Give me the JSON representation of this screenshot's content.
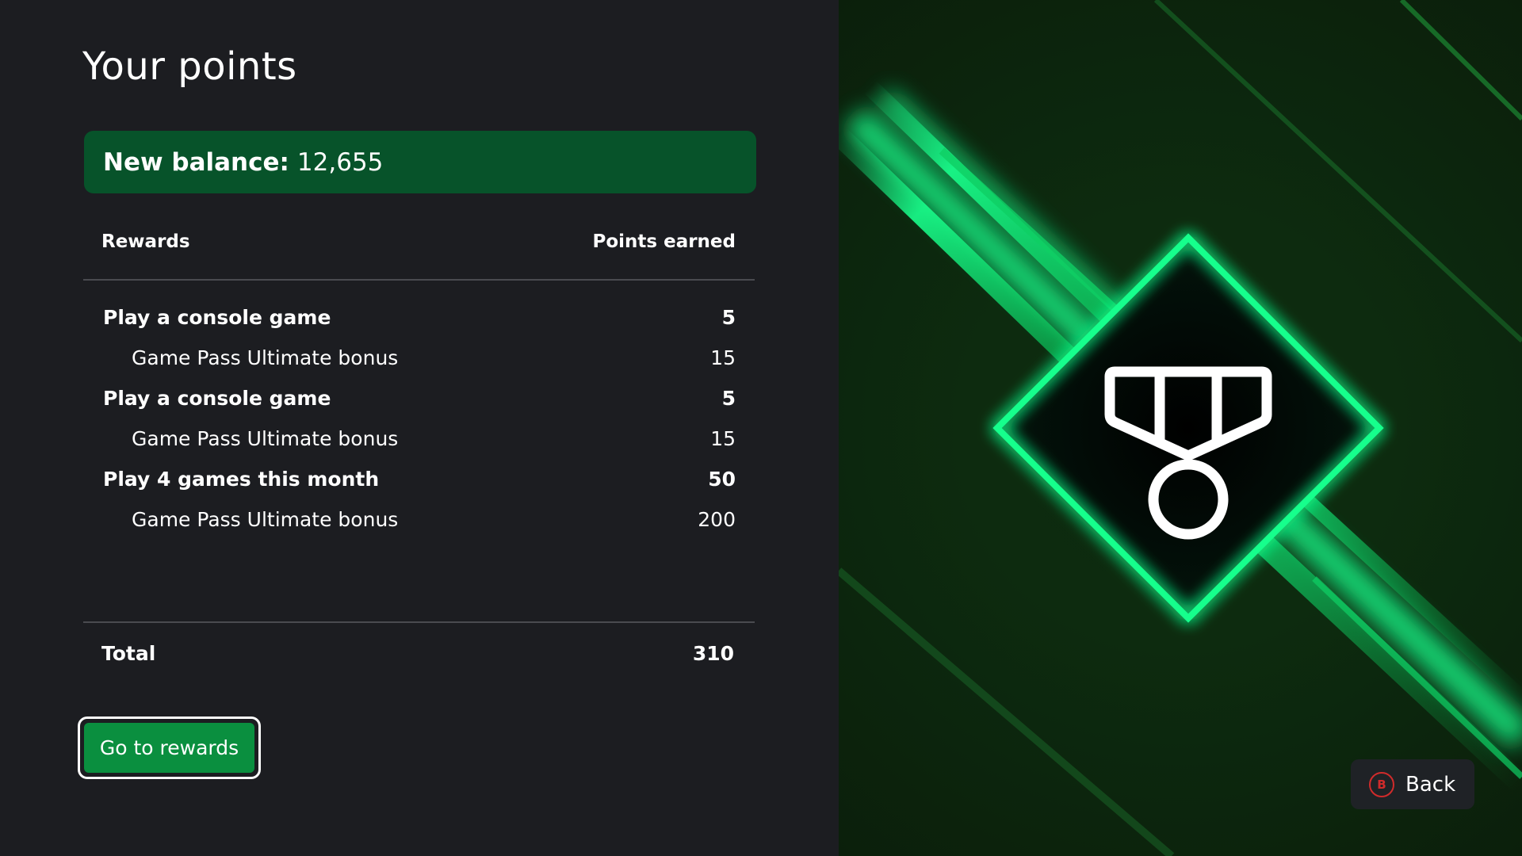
{
  "page": {
    "title": "Your points"
  },
  "balance": {
    "label": "New balance:",
    "value": "12,655"
  },
  "table": {
    "col_rewards": "Rewards",
    "col_points": "Points earned",
    "rows": [
      {
        "name": "Play a console game",
        "points": "5"
      },
      {
        "name": "Game Pass Ultimate bonus",
        "points": "15"
      },
      {
        "name": "Play a console game",
        "points": "5"
      },
      {
        "name": "Game Pass Ultimate bonus",
        "points": "15"
      },
      {
        "name": "Play 4 games this month",
        "points": "50"
      },
      {
        "name": "Game Pass Ultimate bonus",
        "points": "200"
      }
    ],
    "total_label": "Total",
    "total_value": "310"
  },
  "actions": {
    "go_to_rewards": "Go to rewards",
    "back_label": "Back",
    "back_button_glyph": "B"
  },
  "art": {
    "icon": "medal-icon",
    "accent": "#19ff8c",
    "balance_bg": "#07532a",
    "button_bg": "#0a8f3f",
    "controller_b_color": "#d02b2b"
  }
}
